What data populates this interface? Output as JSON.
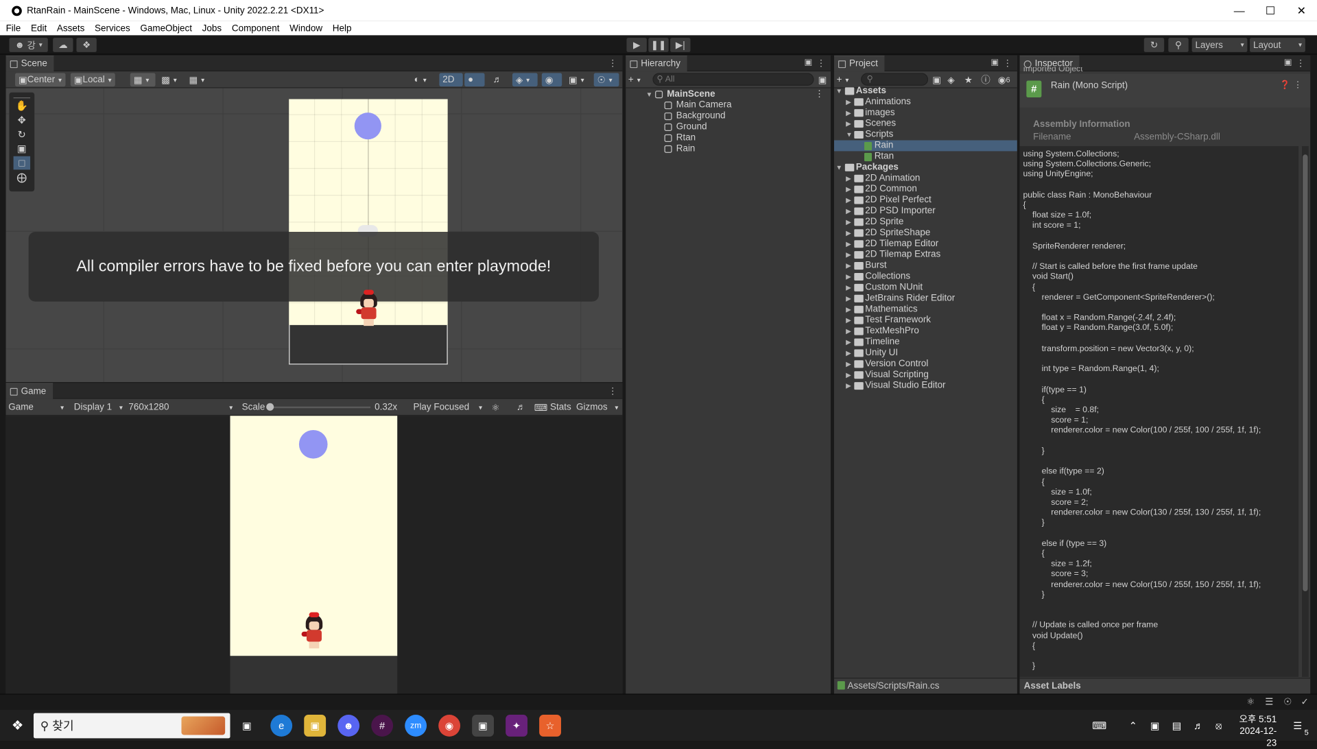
{
  "title": "RtanRain - MainScene - Windows, Mac, Linux - Unity 2022.2.21 <DX11>",
  "menu": [
    "File",
    "Edit",
    "Assets",
    "Services",
    "GameObject",
    "Jobs",
    "Component",
    "Window",
    "Help"
  ],
  "toolbar": {
    "account_label": "강",
    "layers_label": "Layers",
    "layout_label": "Layout"
  },
  "scene": {
    "tab": "Scene",
    "pivot": "Center",
    "space": "Local",
    "mode_2d": "2D",
    "error_message": "All compiler errors have to be fixed before you can enter playmode!"
  },
  "game": {
    "tab": "Game",
    "view": "Game",
    "display": "Display 1",
    "resolution": "760x1280",
    "scale_label": "Scale",
    "scale_value": "0.32x",
    "scale_fraction": 0.0,
    "play_mode": "Play Focused",
    "stats": "Stats",
    "gizmos": "Gizmos"
  },
  "hierarchy": {
    "tab": "Hierarchy",
    "search_placeholder": "All",
    "scene": "MainScene",
    "items": [
      "Main Camera",
      "Background",
      "Ground",
      "Rtan",
      "Rain"
    ]
  },
  "project": {
    "tab": "Project",
    "badge": "6",
    "assets": {
      "label": "Assets",
      "folders": [
        "Animations",
        "images",
        "Scenes",
        "Scripts"
      ],
      "scripts": [
        "Rain",
        "Rtan"
      ]
    },
    "packages": {
      "label": "Packages",
      "items": [
        "2D Animation",
        "2D Common",
        "2D Pixel Perfect",
        "2D PSD Importer",
        "2D Sprite",
        "2D SpriteShape",
        "2D Tilemap Editor",
        "2D Tilemap Extras",
        "Burst",
        "Collections",
        "Custom NUnit",
        "JetBrains Rider Editor",
        "Mathematics",
        "Test Framework",
        "TextMeshPro",
        "Timeline",
        "Unity UI",
        "Version Control",
        "Visual Scripting",
        "Visual Studio Editor"
      ]
    },
    "path": "Assets/Scripts/Rain.cs"
  },
  "inspector": {
    "tab": "Inspector",
    "header_partial": "Imported Object",
    "object_title": "Rain (Mono Script)",
    "assembly_section": "Assembly Information",
    "filename_label": "Filename",
    "filename_value": "Assembly-CSharp.dll",
    "asset_labels": "Asset Labels",
    "code": "using System.Collections;\nusing System.Collections.Generic;\nusing UnityEngine;\n\npublic class Rain : MonoBehaviour\n{\n    float size = 1.0f;\n    int score = 1;\n\n    SpriteRenderer renderer;\n\n    // Start is called before the first frame update\n    void Start()\n    {\n        renderer = GetComponent<SpriteRenderer>();\n\n        float x = Random.Range(-2.4f, 2.4f);\n        float y = Random.Range(3.0f, 5.0f);\n\n        transform.position = new Vector3(x, y, 0);\n\n        int type = Random.Range(1, 4);\n\n        if(type == 1)\n        {\n            size    = 0.8f;\n            score = 1;\n            renderer.color = new Color(100 / 255f, 100 / 255f, 1f, 1f);\n\n        }\n\n        else if(type == 2)\n        {\n            size = 1.0f;\n            score = 2;\n            renderer.color = new Color(130 / 255f, 130 / 255f, 1f, 1f);\n        }\n\n        else if (type == 3)\n        {\n            size = 1.2f;\n            score = 3;\n            renderer.color = new Color(150 / 255f, 150 / 255f, 1f, 1f);\n        }\n\n\n    // Update is called once per frame\n    void Update()\n    {\n\n    }"
  },
  "taskbar": {
    "search_placeholder": "찾기",
    "time": "오후 5:51",
    "date": "2024-12-23",
    "notification_count": "5"
  },
  "colors": {
    "accent": "#46607c",
    "rain": "#9295f3",
    "background": "#fffde0",
    "script_icon": "#5b9a4b"
  }
}
